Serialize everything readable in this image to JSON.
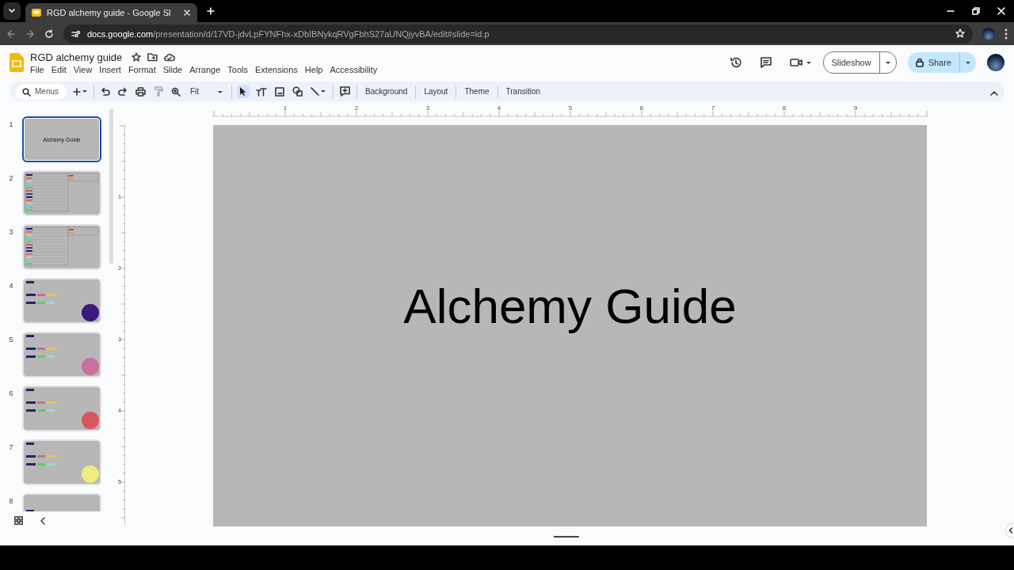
{
  "browser": {
    "tab_title": "RGD alchemy guide - Google Sl",
    "url": {
      "host": "docs.google.com",
      "path": "/presentation/d/17VD-jdvLpFYNFhx-xDbIBNykqRVgFbhS27aUNQjyvBA/edit#slide=id.p"
    }
  },
  "document": {
    "title": "RGD alchemy guide"
  },
  "menu": [
    "File",
    "Edit",
    "View",
    "Insert",
    "Format",
    "Slide",
    "Arrange",
    "Tools",
    "Extensions",
    "Help",
    "Accessibility"
  ],
  "header_buttons": {
    "slideshow": "Slideshow",
    "share": "Share"
  },
  "toolbar": {
    "search_placeholder": "Menus",
    "zoom": "Fit",
    "select_tool": {
      "selected": true
    },
    "paint_format": {
      "disabled": true
    },
    "actions": [
      "Background",
      "Layout",
      "Theme",
      "Transition"
    ]
  },
  "slides": [
    {
      "number": "1",
      "selected": true,
      "kind": "title",
      "title": "Alchemy Guide"
    },
    {
      "number": "2",
      "selected": false,
      "kind": "table"
    },
    {
      "number": "3",
      "selected": false,
      "kind": "table"
    },
    {
      "number": "4",
      "selected": false,
      "kind": "swatch",
      "color": "#3a1a7a"
    },
    {
      "number": "5",
      "selected": false,
      "kind": "swatch",
      "color": "#c8709f"
    },
    {
      "number": "6",
      "selected": false,
      "kind": "swatch",
      "color": "#d9545f"
    },
    {
      "number": "7",
      "selected": false,
      "kind": "swatch",
      "color": "#eeec7a"
    },
    {
      "number": "8",
      "selected": false,
      "kind": "swatch"
    }
  ],
  "ruler": {
    "horizontal": [
      "1",
      "2",
      "3",
      "4",
      "5",
      "6",
      "7",
      "8",
      "9"
    ],
    "vertical": [
      "1",
      "2",
      "3",
      "4",
      "5"
    ]
  },
  "slide": {
    "title": "Alchemy Guide"
  }
}
